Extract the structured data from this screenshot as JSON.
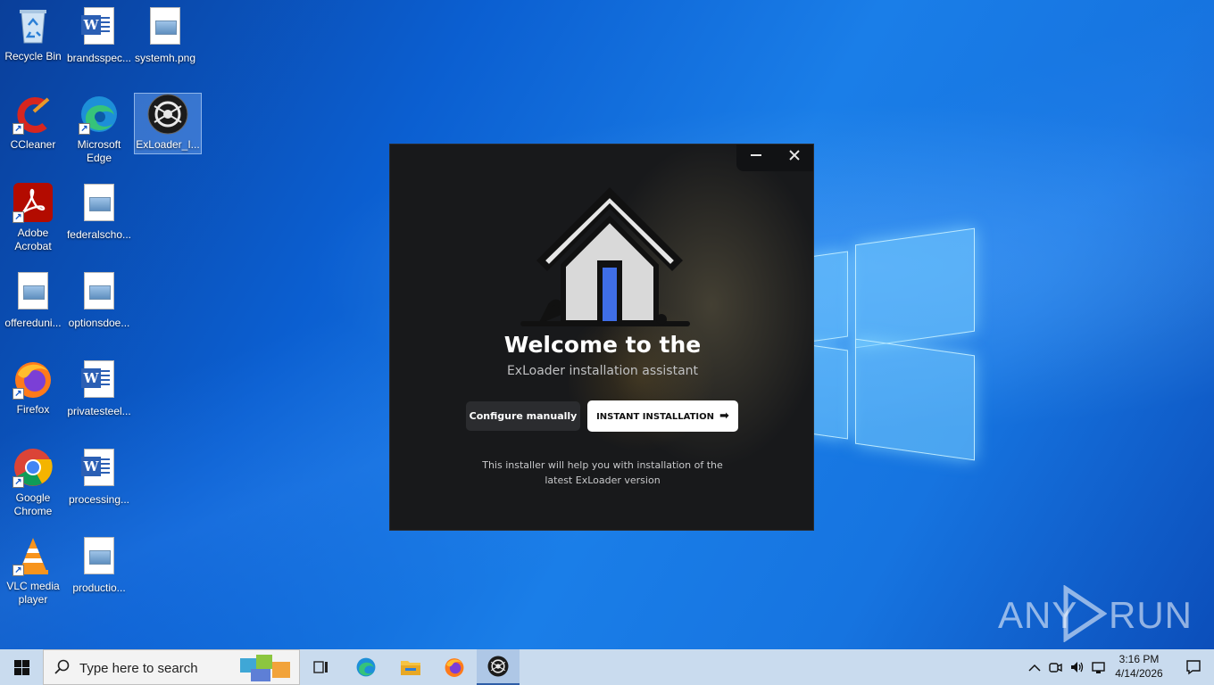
{
  "desktop": {
    "icons": [
      {
        "label": "Recycle Bin",
        "icon": "recycle-bin-icon"
      },
      {
        "label": "brandsspec...",
        "icon": "word-document-icon"
      },
      {
        "label": "systemh.png",
        "icon": "image-file-icon"
      },
      {
        "label": "CCleaner",
        "icon": "ccleaner-icon"
      },
      {
        "label": "Microsoft Edge",
        "icon": "edge-icon"
      },
      {
        "label": "ExLoader_I...",
        "icon": "exloader-icon"
      },
      {
        "label": "Adobe Acrobat",
        "icon": "acrobat-icon"
      },
      {
        "label": "federalscho...",
        "icon": "image-file-icon"
      },
      {
        "label": "offereduni...",
        "icon": "image-file-icon"
      },
      {
        "label": "optionsdoe...",
        "icon": "image-file-icon"
      },
      {
        "label": "Firefox",
        "icon": "firefox-icon"
      },
      {
        "label": "privatesteel...",
        "icon": "word-document-icon"
      },
      {
        "label": "Google Chrome",
        "icon": "chrome-icon"
      },
      {
        "label": "processing...",
        "icon": "word-document-icon"
      },
      {
        "label": "VLC media player",
        "icon": "vlc-icon"
      },
      {
        "label": "productio...",
        "icon": "image-file-icon"
      }
    ]
  },
  "installer": {
    "minimize_icon": "minimize-icon",
    "close_icon": "close-icon",
    "welcome": "Welcome to the",
    "subtitle": "ExLoader installation assistant",
    "configure_button": "Configure manually",
    "instant_button": "INSTANT INSTALLATION",
    "note": "This installer will help you with installation of the latest ExLoader version",
    "accent_color": "#3f6ee8"
  },
  "watermark": {
    "left": "ANY",
    "right": "RUN"
  },
  "taskbar": {
    "search_placeholder": "Type here to search",
    "apps": [
      "task-view-icon",
      "edge-icon",
      "file-explorer-icon",
      "firefox-icon",
      "exloader-icon"
    ],
    "time": "3:16 PM",
    "date": "4/14/2026"
  }
}
